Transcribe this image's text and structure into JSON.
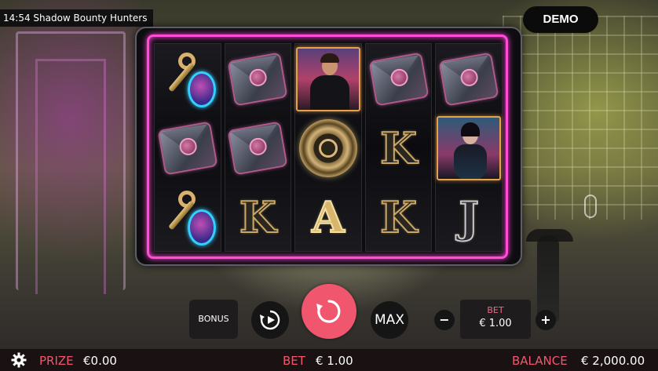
{
  "game": {
    "title": "14:54 Shadow Bounty Hunters",
    "mode_label": "DEMO"
  },
  "reels": [
    [
      "key-tag",
      "envelope",
      "key-tag"
    ],
    [
      "envelope",
      "envelope",
      "K"
    ],
    [
      "man-portrait",
      "coin",
      "A"
    ],
    [
      "envelope",
      "K",
      "K"
    ],
    [
      "envelope",
      "woman-portrait",
      "J"
    ]
  ],
  "controls": {
    "bonus_label": "BONUS",
    "max_label": "MAX",
    "minus_label": "−",
    "plus_label": "+",
    "bet_label": "BET",
    "bet_value": "€ 1.00",
    "autoplay_icon": "autoplay-icon",
    "spin_icon": "spin-icon"
  },
  "status_bar": {
    "prize_label": "PRIZE",
    "prize_value": "€0.00",
    "bet_label": "BET",
    "bet_value": "€ 1.00",
    "balance_label": "BALANCE",
    "balance_value": "€ 2,000.00"
  },
  "colors": {
    "accent": "#f0576f",
    "neon": "#ff4dd8",
    "bar": "#1a1212"
  }
}
